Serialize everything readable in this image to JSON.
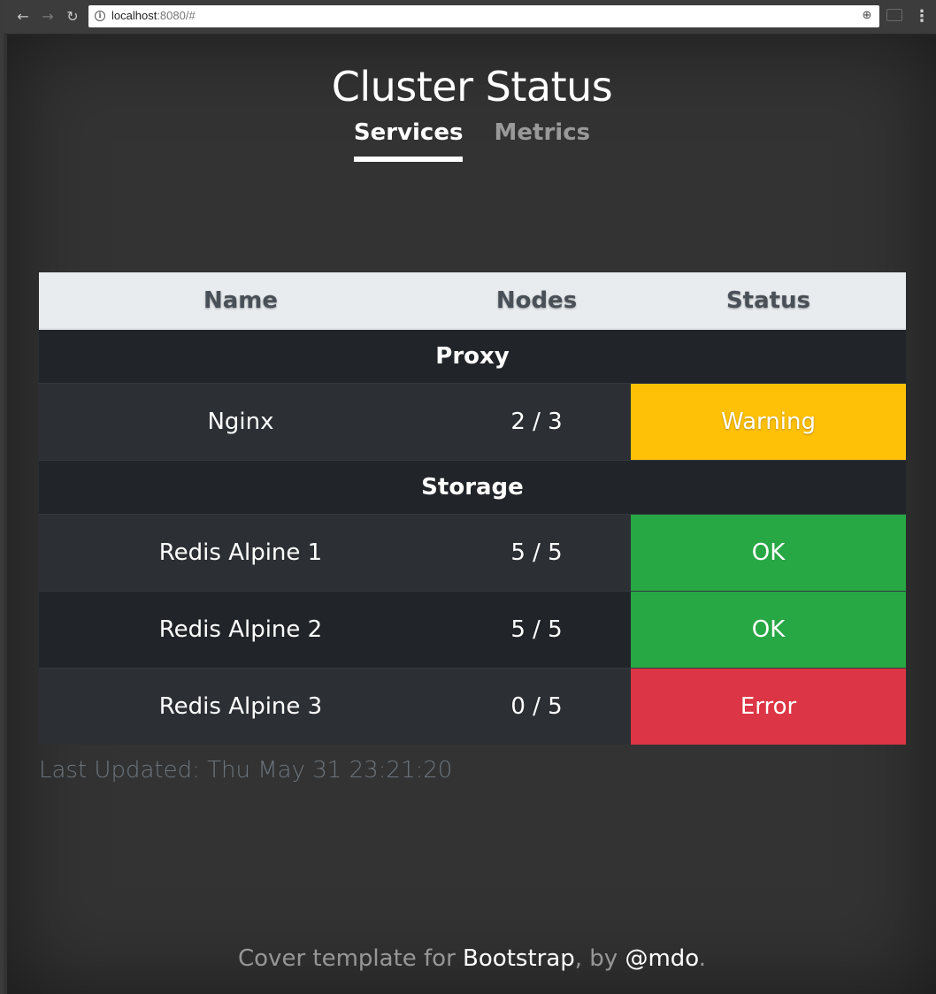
{
  "browser": {
    "url_host": "localhost",
    "url_rest": ":8080/#",
    "back_icon": "arrow-left-icon",
    "forward_icon": "arrow-right-icon",
    "reload_icon": "reload-icon",
    "info_icon": "info-icon",
    "zoom_icon": "zoom-icon",
    "cast_icon": "cast-icon",
    "menu_icon": "menu-icon"
  },
  "header": {
    "title": "Cluster Status",
    "tabs": [
      {
        "label": "Services",
        "active": true
      },
      {
        "label": "Metrics",
        "active": false
      }
    ]
  },
  "table": {
    "columns": [
      "Name",
      "Nodes",
      "Status"
    ],
    "groups": [
      {
        "name": "Proxy",
        "rows": [
          {
            "name": "Nginx",
            "nodes": "2 / 3",
            "status": "Warning"
          }
        ]
      },
      {
        "name": "Storage",
        "rows": [
          {
            "name": "Redis Alpine 1",
            "nodes": "5 / 5",
            "status": "OK"
          },
          {
            "name": "Redis Alpine 2",
            "nodes": "5 / 5",
            "status": "OK"
          },
          {
            "name": "Redis Alpine 3",
            "nodes": "0 / 5",
            "status": "Error"
          }
        ]
      }
    ]
  },
  "status_colors": {
    "Warning": "#ffc107",
    "OK": "#28a745",
    "Error": "#dc3545"
  },
  "last_updated": "Last Updated: Thu May 31 23:21:20",
  "footer": {
    "prefix": "Cover template for ",
    "link1": "Bootstrap",
    "middle": ", by ",
    "link2": "@mdo",
    "suffix": "."
  }
}
